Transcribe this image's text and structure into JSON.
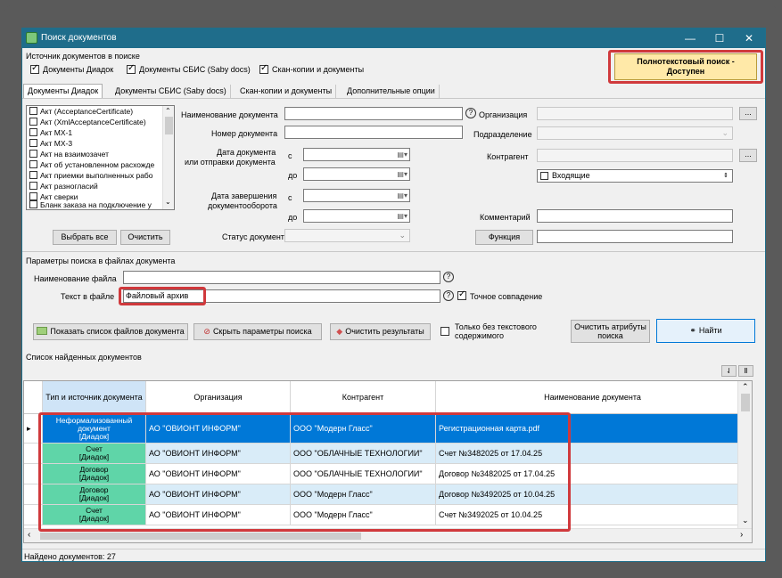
{
  "window": {
    "title": "Поиск документов",
    "minimize": "—",
    "maximize": "☐",
    "close": "✕"
  },
  "source": {
    "group_label": "Источник документов в поиске",
    "diadok": "Документы Диадок",
    "sbis": "Документы СБИС (Saby docs)",
    "scans": "Скан-копии и документы"
  },
  "fulltext": {
    "line1": "Полнотекстовый поиск -",
    "line2": "Доступен"
  },
  "tabs": [
    "Документы Диадок",
    "Документы СБИС (Saby docs)",
    "Скан-копии и документы",
    "Дополнительные опции"
  ],
  "doc_types": [
    "Акт (AcceptanceCertificate)",
    "Акт (XmlAcceptanceCertificate)",
    "Акт МХ-1",
    "Акт МХ-3",
    "Акт на взаимозачет",
    "Акт об установленном расхожде",
    "Акт приемки выполненных рабо",
    "Акт разногласий",
    "Акт сверки",
    "Бланк заказа на подключение у"
  ],
  "buttons": {
    "select_all": "Выбрать все",
    "clear": "Очистить",
    "function": "Функция",
    "ellipsis": "...",
    "show_files": "Показать список файлов документа",
    "hide_params": "Скрыть параметры поиска",
    "clear_results": "Очистить результаты",
    "clear_attrs_1": "Очистить атрибуты",
    "clear_attrs_2": "поиска",
    "find": "Найти"
  },
  "fields": {
    "doc_name": "Наименование документа",
    "doc_number": "Номер документа",
    "doc_date_1": "Дата документа",
    "doc_date_2": "или отправки документа",
    "from": "с",
    "to": "до",
    "flow_end_1": "Дата завершения",
    "flow_end_2": "документооборота",
    "doc_status": "Статус документа",
    "organization": "Организация",
    "subdivision": "Подразделение",
    "counterparty": "Контрагент",
    "incoming": "Входящие",
    "comment": "Комментарий",
    "help": "?"
  },
  "file_params": {
    "group_label": "Параметры поиска в файлах документа",
    "file_name": "Наименование файла",
    "text_in_file": "Текст в файле",
    "text_value": "Файловый архив",
    "exact_match": "Точное совпадение",
    "no_text_1": "Только без текстового",
    "no_text_2": "содержимого"
  },
  "results": {
    "label": "Список найденных документов",
    "columns": [
      "Тип и источник документа",
      "Организация",
      "Контрагент",
      "Наименование документа"
    ],
    "rows": [
      {
        "type1": "Неформализованный",
        "type2": "документ",
        "type3": "[Диадок]",
        "org": "АО \"ОВИОНТ ИНФОРМ\"",
        "counterparty": "ООО \"Модерн Гласс\"",
        "name": "Регистрационная карта.pdf"
      },
      {
        "type1": "Счет",
        "type2": "[Диадок]",
        "type3": "",
        "org": "АО \"ОВИОНТ ИНФОРМ\"",
        "counterparty": "ООО \"ОБЛАЧНЫЕ ТЕХНОЛОГИИ\"",
        "name": "Счет №3482025 от 17.04.25"
      },
      {
        "type1": "Договор",
        "type2": "[Диадок]",
        "type3": "",
        "org": "АО \"ОВИОНТ ИНФОРМ\"",
        "counterparty": "ООО \"ОБЛАЧНЫЕ ТЕХНОЛОГИИ\"",
        "name": "Договор №3482025 от 17.04.25"
      },
      {
        "type1": "Договор",
        "type2": "[Диадок]",
        "type3": "",
        "org": "АО \"ОВИОНТ ИНФОРМ\"",
        "counterparty": "ООО \"Модерн Гласс\"",
        "name": "Договор №3492025 от 10.04.25"
      },
      {
        "type1": "Счет",
        "type2": "[Диадок]",
        "type3": "",
        "org": "АО \"ОВИОНТ ИНФОРМ\"",
        "counterparty": "ООО \"Модерн Гласс\"",
        "name": "Счет №3492025 от 10.04.25"
      }
    ]
  },
  "status": "Найдено документов: 27",
  "colors": {
    "title_bar": "#1f6d8b",
    "selected_row": "#0078d7",
    "type_cell": "#5fd5a8",
    "header_selected": "#cfe4f7",
    "alt_row": "#d9ecf8",
    "highlight": "#d0393c",
    "fulltext_bg": "#ffe9a8"
  }
}
